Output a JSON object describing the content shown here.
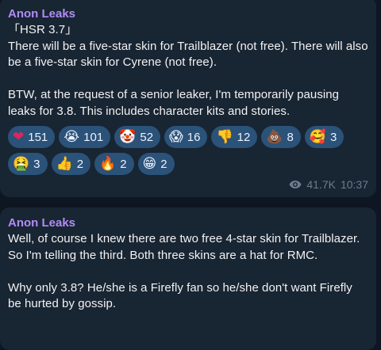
{
  "messages": [
    {
      "author": "Anon Leaks",
      "text": "「HSR 3.7」\nThere will be a five-star skin for Trailblazer (not free). There will also be a five-star skin for Cyrene (not free).\n\nBTW, at the request of a senior leaker, I'm temporarily pausing leaks for 3.8. This includes character kits and stories.",
      "reactions_row1": [
        {
          "emoji": "❤",
          "count": "151",
          "color": "#e0245e"
        },
        {
          "emoji": "😭",
          "count": "101"
        },
        {
          "emoji": "🤡",
          "count": "52"
        },
        {
          "emoji": "😱",
          "count": "16"
        },
        {
          "emoji": "👎",
          "count": "12"
        },
        {
          "emoji": "💩",
          "count": "8"
        },
        {
          "emoji": "🥰",
          "count": "3"
        }
      ],
      "reactions_row2": [
        {
          "emoji": "🤮",
          "count": "3"
        },
        {
          "emoji": "👍",
          "count": "2"
        },
        {
          "emoji": "🔥",
          "count": "2"
        },
        {
          "emoji": "😁",
          "count": "2"
        }
      ],
      "views": "41.7K",
      "time": "10:37"
    },
    {
      "author": "Anon Leaks",
      "text": "Well, of course I knew there are two free 4-star skin for Trailblazer. So I'm telling the third. Both three skins are a hat for RMC.\n\nWhy only 3.8? He/she is a Firefly fan so he/she don't want Firefly be hurted by gossip."
    }
  ],
  "colors": {
    "background": "#0e1621",
    "bubble": "#182533",
    "author": "#b18cf5",
    "reaction_chip": "#2b5278",
    "meta": "#6c7d8e"
  }
}
